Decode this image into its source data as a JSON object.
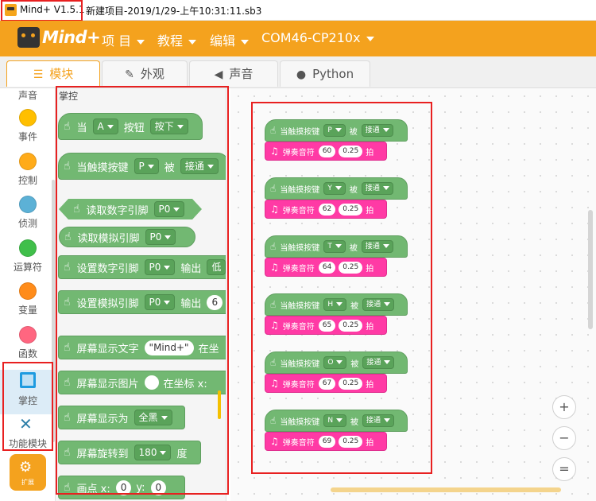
{
  "titlebar": {
    "app_name": "Mind+ V1.5.1",
    "file_name": "新建项目-2019/1/29-上午10:31:11.sb3"
  },
  "menubar": {
    "logo_text": "Mind+",
    "items": [
      "项 目",
      "教程",
      "编辑",
      "COM46-CP210x"
    ]
  },
  "tabs": [
    {
      "label": "模块",
      "icon": "blocks-icon"
    },
    {
      "label": "外观",
      "icon": "brush-icon"
    },
    {
      "label": "声音",
      "icon": "speaker-icon"
    },
    {
      "label": "Python",
      "icon": "python-icon"
    }
  ],
  "categories": [
    {
      "label": "声音",
      "color": "#cf63cf"
    },
    {
      "label": "事件",
      "color": "#ffbf00"
    },
    {
      "label": "控制",
      "color": "#ffab19"
    },
    {
      "label": "侦测",
      "color": "#5cb1d6"
    },
    {
      "label": "运算符",
      "color": "#40bf4a"
    },
    {
      "label": "变量",
      "color": "#ff8c1a"
    },
    {
      "label": "函数",
      "color": "#ff6680"
    },
    {
      "label": "掌控",
      "color": "#1e9be0"
    },
    {
      "label": "功能模块",
      "color": "#2c7ea8"
    }
  ],
  "extension_label": "扩展",
  "palette": {
    "title": "掌控",
    "blocks": {
      "b1": {
        "t1": "当",
        "d1": "A",
        "t2": "按钮",
        "d2": "按下"
      },
      "b2": {
        "t1": "当触摸按键",
        "d1": "P",
        "t2": "被",
        "d2": "接通"
      },
      "b3": {
        "t1": "读取数字引脚",
        "d1": "P0"
      },
      "b4": {
        "t1": "读取模拟引脚",
        "d1": "P0"
      },
      "b5": {
        "t1": "设置数字引脚",
        "d1": "P0",
        "t2": "输出",
        "v1": "低"
      },
      "b6": {
        "t1": "设置模拟引脚",
        "d1": "P0",
        "t2": "输出",
        "v1": "6"
      },
      "b7": {
        "t1": "屏幕显示文字",
        "v1": "\"Mind+\"",
        "t2": "在坐"
      },
      "b8": {
        "t1": "屏幕显示图片",
        "t2": "在坐标 x:"
      },
      "b9": {
        "t1": "屏幕显示为",
        "d1": "全黑"
      },
      "b10": {
        "t1": "屏幕旋转到",
        "d1": "180",
        "t2": "度"
      },
      "b11": {
        "t1": "画点 x:",
        "v1": "0",
        "t2": "y:",
        "v2": "0"
      }
    }
  },
  "workspace": {
    "hat_text": "当触摸按键",
    "hat_mid": "被",
    "play_text": "弹奏音符",
    "beat_text": "拍",
    "stacks": [
      {
        "key": "P",
        "state": "接通",
        "note": "60",
        "beat": "0.25"
      },
      {
        "key": "Y",
        "state": "接通",
        "note": "62",
        "beat": "0.25"
      },
      {
        "key": "T",
        "state": "接通",
        "note": "64",
        "beat": "0.25"
      },
      {
        "key": "H",
        "state": "接通",
        "note": "65",
        "beat": "0.25"
      },
      {
        "key": "O",
        "state": "接通",
        "note": "67",
        "beat": "0.25"
      },
      {
        "key": "N",
        "state": "接通",
        "note": "69",
        "beat": "0.25"
      }
    ]
  },
  "zoom": {
    "in": "+",
    "out": "−",
    "reset": "="
  }
}
